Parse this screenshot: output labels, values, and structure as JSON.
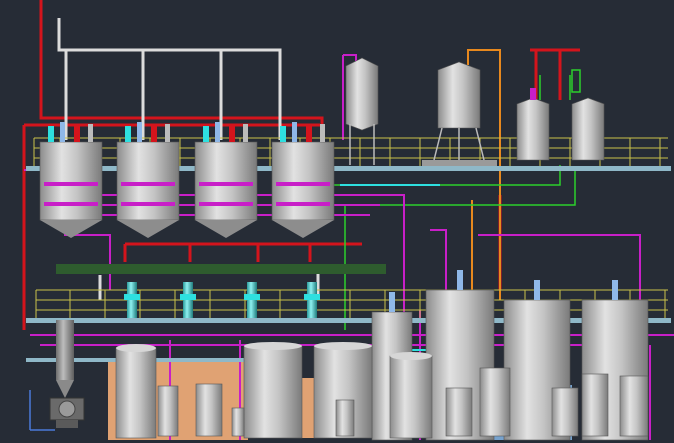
{
  "viewport": {
    "background": "#262c36"
  },
  "palette": {
    "steam": "#d4141c",
    "water": "#c81fc8",
    "product": "#e0e0e0",
    "cooling": "#2ee0e0",
    "air": "#e8891e",
    "drain": "#2cd02c",
    "railing": "#c9c24a",
    "platform": "#8fb8c8",
    "vessel": "#bdbdbd"
  },
  "equipment": {
    "steam_header": {
      "icon": "steam-header-pipe"
    },
    "upper_platform": {
      "icon": "upper-platform"
    },
    "lower_platform": {
      "icon": "lower-platform"
    },
    "fermenters": {
      "count": 4,
      "icon": "conical-fermenter"
    },
    "storage_tank": {
      "icon": "vertical-storage-tank"
    },
    "mixing_tank": {
      "icon": "legged-mixing-tank"
    },
    "pressure_vessels": {
      "count": 2,
      "icon": "pressure-vessel"
    },
    "filter_skid": {
      "pumps": 4,
      "icon": "filter-pump"
    },
    "receiver_tanks": {
      "count": 4,
      "icon": "receiver-tank"
    },
    "floor_tanks": {
      "count": 4,
      "icon": "floor-tank"
    },
    "small_tanks": {
      "count": 9,
      "icon": "small-tank"
    },
    "heat_exchanger": {
      "icon": "heat-exchanger"
    },
    "motor_pump": {
      "icon": "motor-pump"
    },
    "cip_pad": {
      "icon": "cip-pad"
    }
  }
}
